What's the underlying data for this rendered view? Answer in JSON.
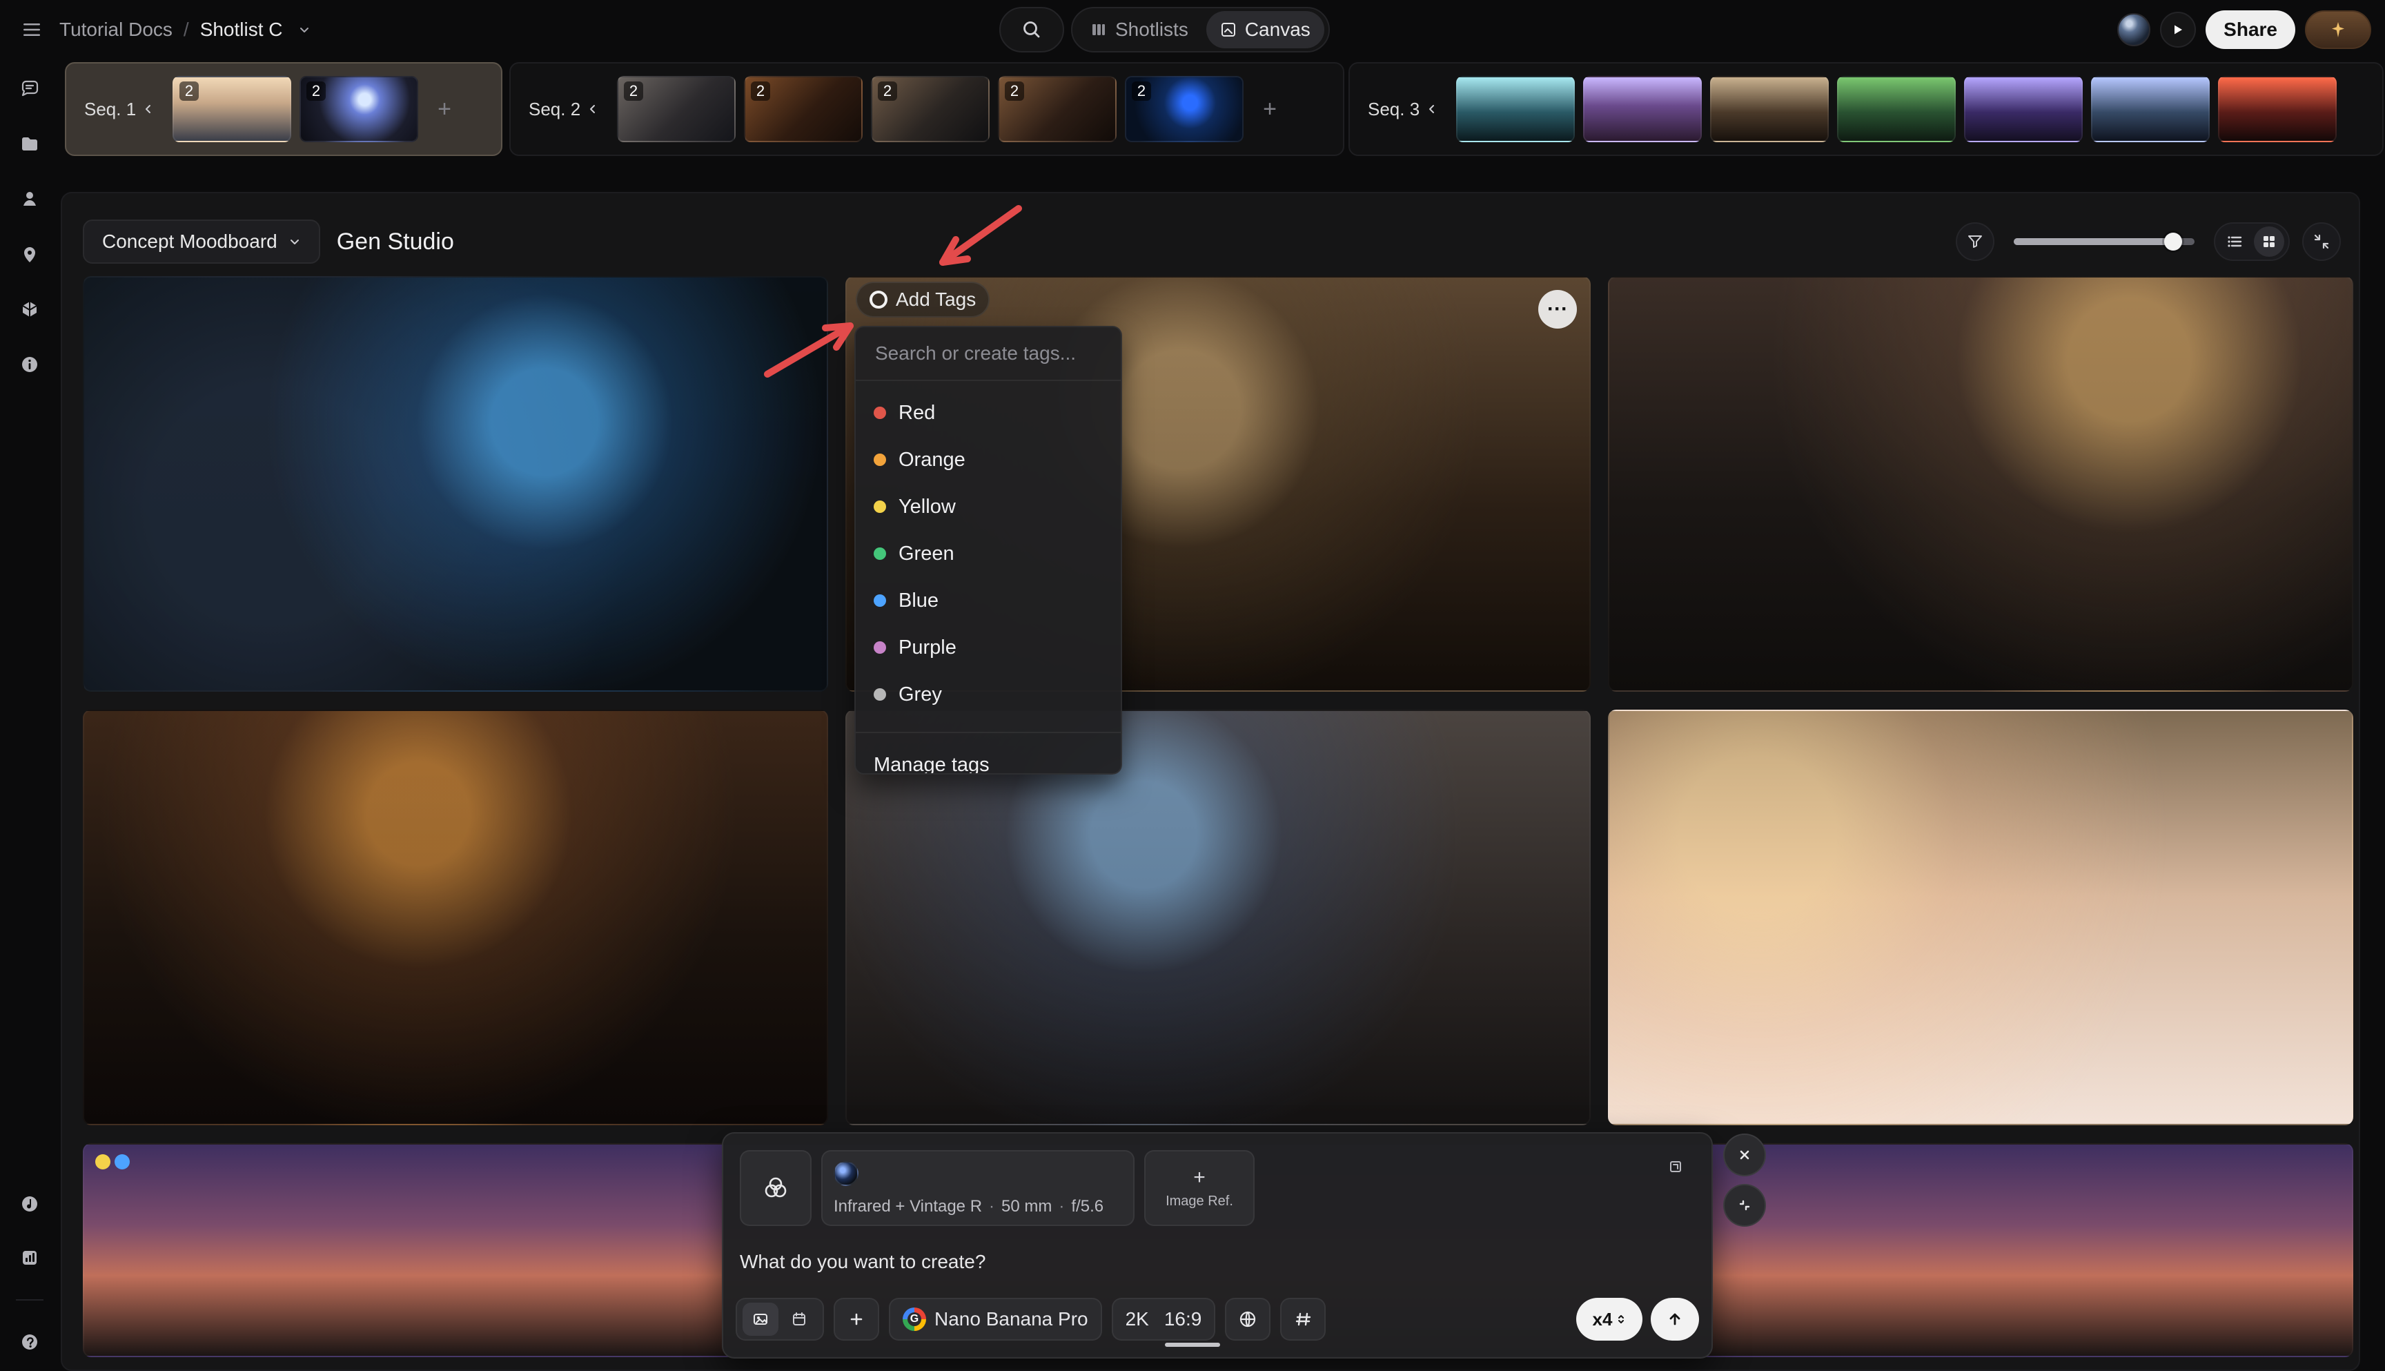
{
  "topbar": {
    "breadcrumb": [
      {
        "label": "Tutorial Docs"
      },
      {
        "label": "Shotlist C"
      }
    ],
    "center_tabs": [
      {
        "label": "Shotlists",
        "icon": "shotlists-icon"
      },
      {
        "label": "Canvas",
        "icon": "canvas-icon",
        "active": true
      }
    ],
    "share_label": "Share"
  },
  "sequences": [
    {
      "label": "Seq. 1",
      "active": true,
      "thumb_counts": [
        "2",
        "2"
      ]
    },
    {
      "label": "Seq. 2",
      "active": false,
      "thumb_counts": [
        "2",
        "2",
        "2",
        "2",
        "2"
      ]
    },
    {
      "label": "Seq. 3",
      "active": false,
      "thumb_counts": []
    }
  ],
  "board": {
    "moodboard_label": "Concept Moodboard",
    "title": "Gen Studio",
    "zoom_fraction": 0.88
  },
  "tags": {
    "add_label": "Add Tags",
    "search_placeholder": "Search or create tags...",
    "items": [
      {
        "label": "Red",
        "color": "#e0564a"
      },
      {
        "label": "Orange",
        "color": "#f3a33b"
      },
      {
        "label": "Yellow",
        "color": "#f3d24a"
      },
      {
        "label": "Green",
        "color": "#44c67a"
      },
      {
        "label": "Blue",
        "color": "#4da3ff"
      },
      {
        "label": "Purple",
        "color": "#c783c8"
      },
      {
        "label": "Grey",
        "color": "#b7b7b7"
      }
    ],
    "manage_label": "Manage tags"
  },
  "composer": {
    "style_meta": {
      "name": "Infrared + Vintage R",
      "lens": "50 mm",
      "aperture": "f/5.6"
    },
    "image_ref_label": "Image Ref.",
    "prompt_placeholder": "What do you want to create?",
    "model_label": "Nano Banana Pro",
    "resolution": "2K",
    "aspect": "16:9",
    "count_label": "x4"
  },
  "colors": {
    "accent": "#f0c06b"
  }
}
